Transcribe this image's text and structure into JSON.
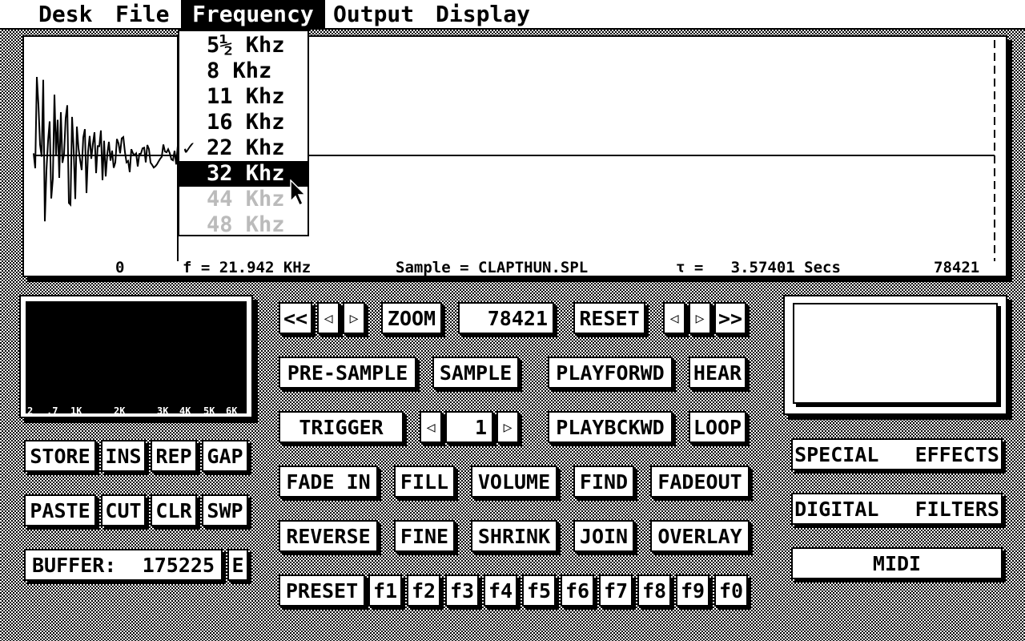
{
  "menubar": {
    "items": [
      "Desk",
      "File",
      "Frequency",
      "Output",
      "Display"
    ],
    "active": "Frequency"
  },
  "frequency_menu": {
    "items": [
      {
        "label": "5½ Khz",
        "state": "normal"
      },
      {
        "label": "8 Khz",
        "state": "normal"
      },
      {
        "label": "11 Khz",
        "state": "normal"
      },
      {
        "label": "16 Khz",
        "state": "normal"
      },
      {
        "label": "22 Khz",
        "state": "checked"
      },
      {
        "label": "32 Khz",
        "state": "highlighted"
      },
      {
        "label": "44 Khz",
        "state": "disabled"
      },
      {
        "label": "48 Khz",
        "state": "disabled"
      }
    ],
    "check_mark": "✓"
  },
  "waveform": {
    "start_label": "0",
    "frequency_text": "f = 21.942 KHz",
    "sample_text": "Sample = CLAPTHUN.SPL",
    "time_text": "τ =   3.57401 Secs",
    "end_label": "78421"
  },
  "spectrum": {
    "ticks": [
      "2",
      ".7",
      "1K",
      "2K",
      "3K",
      "4K",
      "5K",
      "6K"
    ]
  },
  "nav_row": {
    "rewind": "<<",
    "zoom": "ZOOM",
    "position": "78421",
    "reset": "RESET",
    "forward": ">>"
  },
  "sample_controls": {
    "pre_sample": "PRE-SAMPLE",
    "sample": "SAMPLE",
    "trigger": "TRIGGER",
    "trigger_value": "1"
  },
  "play_controls": {
    "play_forward": "PLAYFORWD",
    "hear": "HEAR",
    "play_backward": "PLAYBCKWD",
    "loop": "LOOP"
  },
  "edit_controls": {
    "fade_in": "FADE IN",
    "fill": "FILL",
    "volume": "VOLUME",
    "find": "FIND",
    "fadeout": "FADEOUT",
    "reverse": "REVERSE",
    "fine": "FINE",
    "shrink": "SHRINK",
    "join": "JOIN",
    "overlay": "OVERLAY"
  },
  "presets": {
    "preset": "PRESET",
    "keys": [
      "f1",
      "f2",
      "f3",
      "f4",
      "f5",
      "f6",
      "f7",
      "f8",
      "f9",
      "f0"
    ]
  },
  "buffer_controls": {
    "store": "STORE",
    "ins": "INS",
    "rep": "REP",
    "gap": "GAP",
    "paste": "PASTE",
    "cut": "CUT",
    "clr": "CLR",
    "swp": "SWP",
    "buffer_label": "BUFFER:",
    "buffer_value": "175225",
    "e": "E"
  },
  "effects": {
    "special_effects": "SPECIAL   EFFECTS",
    "digital_filters": "DIGITAL   FILTERS",
    "midi": "MIDI"
  }
}
